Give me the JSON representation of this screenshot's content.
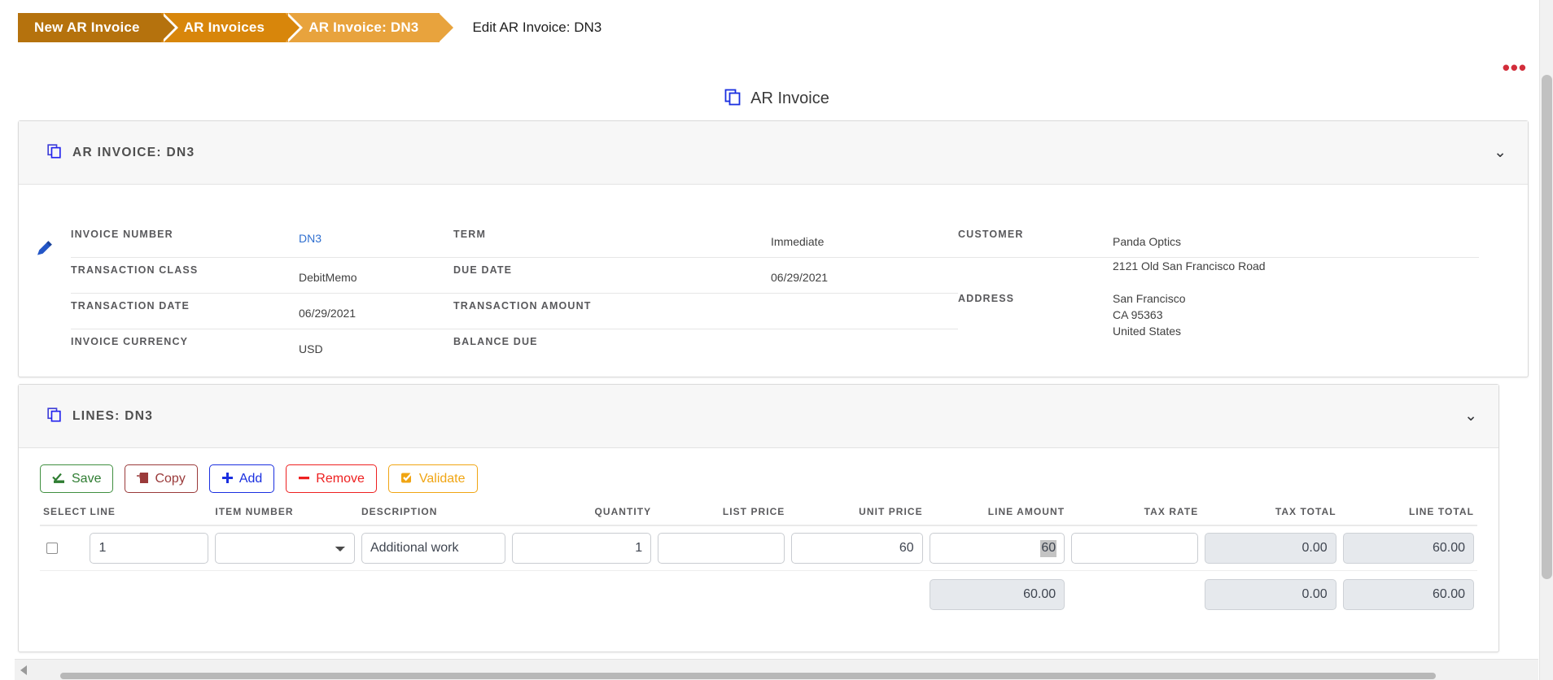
{
  "breadcrumb": {
    "items": [
      {
        "label": "New AR Invoice"
      },
      {
        "label": "AR Invoices"
      },
      {
        "label": "AR Invoice: DN3"
      }
    ],
    "current_page_title": "Edit AR Invoice: DN3"
  },
  "overflow_menu": {
    "glyph": "•••"
  },
  "page_title": {
    "text": "AR Invoice",
    "icon": "copy-icon"
  },
  "invoice_card": {
    "title": "AR INVOICE: DN3",
    "icon": "copy-icon",
    "collapse_glyph": "⌄",
    "edit_icon": "pencil-icon",
    "columns": [
      {
        "fields": [
          {
            "label": "INVOICE NUMBER",
            "value": "DN3",
            "style": "link"
          },
          {
            "label": "TRANSACTION CLASS",
            "value": "DebitMemo",
            "style": "text"
          },
          {
            "label": "TRANSACTION DATE",
            "value": "06/29/2021",
            "style": "text"
          },
          {
            "label": "INVOICE CURRENCY",
            "value": "USD",
            "style": "text"
          }
        ]
      },
      {
        "fields": [
          {
            "label": "TERM",
            "value": "Immediate",
            "style": "text"
          },
          {
            "label": "DUE DATE",
            "value": "06/29/2021",
            "style": "text"
          },
          {
            "label": "TRANSACTION AMOUNT",
            "value": "",
            "style": "text"
          },
          {
            "label": "BALANCE DUE",
            "value": "",
            "style": "text"
          }
        ]
      },
      {
        "fields": [
          {
            "label": "CUSTOMER",
            "value": "Panda Optics",
            "style": "text"
          },
          {
            "label": "ADDRESS",
            "value": "2121 Old San Francisco Road\n\nSan Francisco\nCA 95363\nUnited States",
            "style": "text"
          }
        ]
      }
    ]
  },
  "lines_card": {
    "title": "LINES: DN3",
    "icon": "copy-icon",
    "collapse_glyph": "⌄",
    "toolbar": [
      {
        "label": "Save",
        "icon": "save-icon",
        "color": "#2f7d32"
      },
      {
        "label": "Copy",
        "icon": "copy-paste-icon",
        "color": "#9a3a3a"
      },
      {
        "label": "Add",
        "icon": "plus-icon",
        "color": "#1a2fe0"
      },
      {
        "label": "Remove",
        "icon": "minus-icon",
        "color": "#ee2020"
      },
      {
        "label": "Validate",
        "icon": "check-box-icon",
        "color": "#f0a513"
      }
    ],
    "columns": [
      {
        "key": "select",
        "label": "SELECT",
        "align": "left"
      },
      {
        "key": "line",
        "label": "LINE",
        "align": "left"
      },
      {
        "key": "item_number",
        "label": "ITEM NUMBER",
        "align": "left"
      },
      {
        "key": "description",
        "label": "DESCRIPTION",
        "align": "left"
      },
      {
        "key": "quantity",
        "label": "QUANTITY",
        "align": "right"
      },
      {
        "key": "list_price",
        "label": "LIST PRICE",
        "align": "right"
      },
      {
        "key": "unit_price",
        "label": "UNIT PRICE",
        "align": "right"
      },
      {
        "key": "line_amount",
        "label": "LINE AMOUNT",
        "align": "right"
      },
      {
        "key": "tax_rate",
        "label": "TAX RATE",
        "align": "right"
      },
      {
        "key": "tax_total",
        "label": "TAX TOTAL",
        "align": "right"
      },
      {
        "key": "line_total",
        "label": "LINE TOTAL",
        "align": "right"
      }
    ],
    "rows": [
      {
        "selected": false,
        "line": "1",
        "item_number": "",
        "description": "Additional work",
        "quantity": "1",
        "list_price": "",
        "unit_price": "60",
        "line_amount": "60",
        "line_amount_highlighted": true,
        "tax_rate": "",
        "tax_total": "0.00",
        "line_total": "60.00"
      }
    ],
    "totals": {
      "line_amount": "60.00",
      "tax_rate": "",
      "tax_total": "0.00",
      "line_total": "60.00"
    }
  },
  "scrollbars": {
    "vertical_present": true,
    "horizontal_present": true,
    "left_arrow_glyph": "◀"
  }
}
